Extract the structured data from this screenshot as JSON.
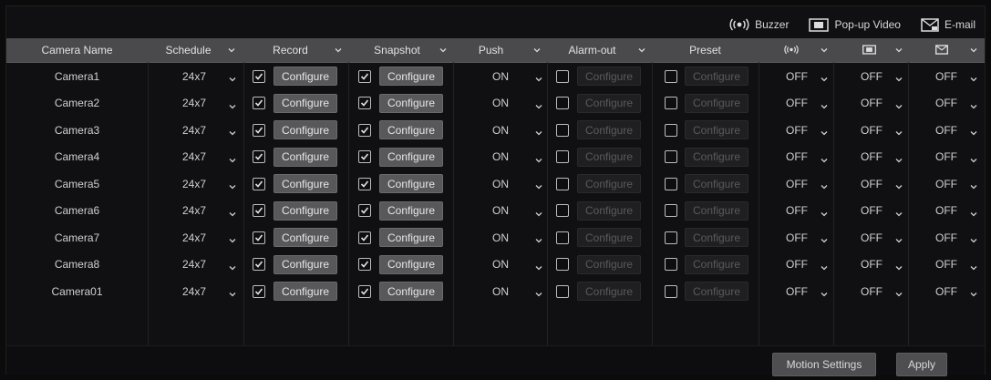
{
  "legend": {
    "buzzer": "Buzzer",
    "popup": "Pop-up Video",
    "email": "E-mail"
  },
  "headers": {
    "camera_name": "Camera Name",
    "schedule": "Schedule",
    "record": "Record",
    "snapshot": "Snapshot",
    "push": "Push",
    "alarm_out": "Alarm-out",
    "preset": "Preset"
  },
  "rows": [
    {
      "name": "Camera1",
      "schedule": "24x7",
      "record": "Configure",
      "snapshot": "Configure",
      "push": "ON",
      "alarm": "Configure",
      "preset": "Configure",
      "buzzer": "OFF",
      "popup": "OFF",
      "email": "OFF"
    },
    {
      "name": "Camera2",
      "schedule": "24x7",
      "record": "Configure",
      "snapshot": "Configure",
      "push": "ON",
      "alarm": "Configure",
      "preset": "Configure",
      "buzzer": "OFF",
      "popup": "OFF",
      "email": "OFF"
    },
    {
      "name": "Camera3",
      "schedule": "24x7",
      "record": "Configure",
      "snapshot": "Configure",
      "push": "ON",
      "alarm": "Configure",
      "preset": "Configure",
      "buzzer": "OFF",
      "popup": "OFF",
      "email": "OFF"
    },
    {
      "name": "Camera4",
      "schedule": "24x7",
      "record": "Configure",
      "snapshot": "Configure",
      "push": "ON",
      "alarm": "Configure",
      "preset": "Configure",
      "buzzer": "OFF",
      "popup": "OFF",
      "email": "OFF"
    },
    {
      "name": "Camera5",
      "schedule": "24x7",
      "record": "Configure",
      "snapshot": "Configure",
      "push": "ON",
      "alarm": "Configure",
      "preset": "Configure",
      "buzzer": "OFF",
      "popup": "OFF",
      "email": "OFF"
    },
    {
      "name": "Camera6",
      "schedule": "24x7",
      "record": "Configure",
      "snapshot": "Configure",
      "push": "ON",
      "alarm": "Configure",
      "preset": "Configure",
      "buzzer": "OFF",
      "popup": "OFF",
      "email": "OFF"
    },
    {
      "name": "Camera7",
      "schedule": "24x7",
      "record": "Configure",
      "snapshot": "Configure",
      "push": "ON",
      "alarm": "Configure",
      "preset": "Configure",
      "buzzer": "OFF",
      "popup": "OFF",
      "email": "OFF"
    },
    {
      "name": "Camera8",
      "schedule": "24x7",
      "record": "Configure",
      "snapshot": "Configure",
      "push": "ON",
      "alarm": "Configure",
      "preset": "Configure",
      "buzzer": "OFF",
      "popup": "OFF",
      "email": "OFF"
    },
    {
      "name": "Camera01",
      "schedule": "24x7",
      "record": "Configure",
      "snapshot": "Configure",
      "push": "ON",
      "alarm": "Configure",
      "preset": "Configure",
      "buzzer": "OFF",
      "popup": "OFF",
      "email": "OFF"
    }
  ],
  "footer": {
    "motion_settings": "Motion Settings",
    "apply": "Apply"
  },
  "colors": {
    "header_bg": "#4a4a4d",
    "button_enabled": "#58585b",
    "button_disabled": "#1f1f21"
  }
}
